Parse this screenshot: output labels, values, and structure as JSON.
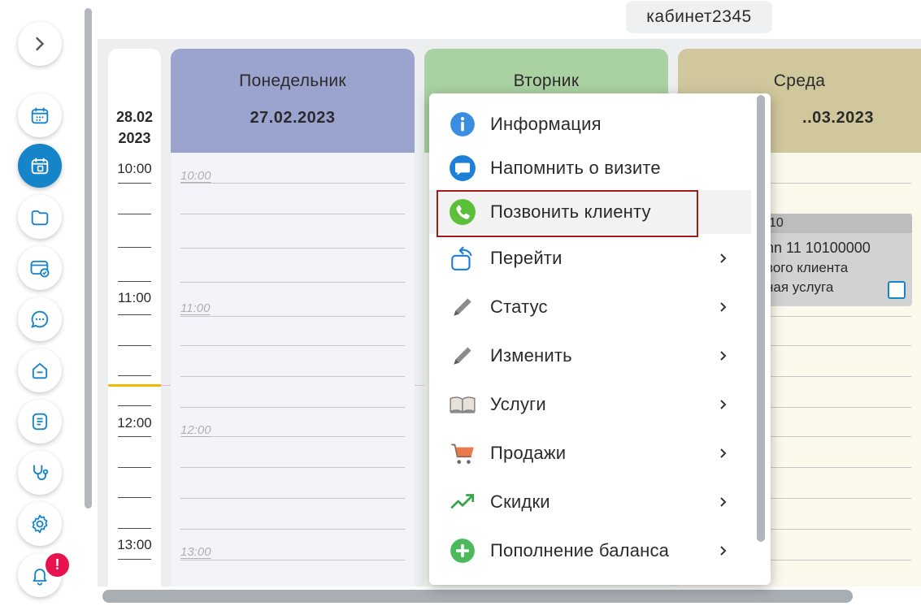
{
  "room": "кабинет2345",
  "sidebar": {
    "items": [
      {
        "icon": "chevron-right-icon"
      },
      {
        "icon": "calendar-icon"
      },
      {
        "icon": "calendar-active-icon"
      },
      {
        "icon": "folder-icon"
      },
      {
        "icon": "card-check-icon"
      },
      {
        "icon": "chat-icon"
      },
      {
        "icon": "home-icon"
      },
      {
        "icon": "document-icon"
      },
      {
        "icon": "stethoscope-icon"
      },
      {
        "icon": "gear-icon"
      },
      {
        "icon": "bell-icon"
      }
    ],
    "notification_badge": "!"
  },
  "time_column": {
    "date_line1": "28.02",
    "date_line2": "2023",
    "hours": [
      "10:00",
      "11:00",
      "12:00",
      "13:00"
    ]
  },
  "days": [
    {
      "name": "Понедельник",
      "date": "27.02.2023",
      "color": "#9ba3cf",
      "body_color": "#f3f4fa",
      "slot_times": [
        "10:00",
        "11:00",
        "12:00",
        "13:00"
      ]
    },
    {
      "name": "Вторник",
      "date": "",
      "color": "#a9d1a2",
      "body_color": "#f2f8f1",
      "slot_times": []
    },
    {
      "name": "Среда",
      "date": "..03.2023",
      "color": "#d0c79c",
      "body_color": "#fbf9ec",
      "slot_times": []
    }
  ],
  "appointment": {
    "head": "10",
    "line1": "nn 11  10100000",
    "line2": "вого клиента",
    "line3": "ная услуга"
  },
  "context_menu": {
    "items": [
      {
        "label": "Информация",
        "icon": "info-icon",
        "submenu": false
      },
      {
        "label": "Напомнить о визите",
        "icon": "message-icon",
        "submenu": false
      },
      {
        "label": "Позвонить клиенту",
        "icon": "phone-icon",
        "submenu": false
      },
      {
        "label": "Перейти",
        "icon": "goto-icon",
        "submenu": true
      },
      {
        "label": "Статус",
        "icon": "pencil-icon",
        "submenu": true
      },
      {
        "label": "Изменить",
        "icon": "edit-icon",
        "submenu": true
      },
      {
        "label": "Услуги",
        "icon": "book-icon",
        "submenu": true
      },
      {
        "label": "Продажи",
        "icon": "cart-icon",
        "submenu": true
      },
      {
        "label": "Скидки",
        "icon": "trend-icon",
        "submenu": true
      },
      {
        "label": "Пополнение баланса",
        "icon": "plus-circle-icon",
        "submenu": true
      }
    ],
    "highlighted_index": 2
  },
  "colors": {
    "accent": "#1584c8",
    "now_line": "#f3b800",
    "highlight_border": "#9e1d1d",
    "badge": "#e8124f"
  }
}
